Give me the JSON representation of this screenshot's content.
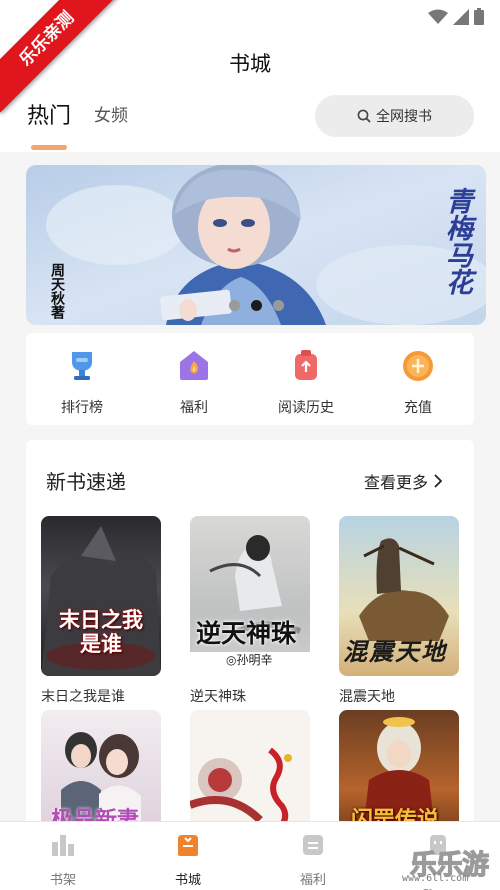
{
  "watermark_top": "乐乐亲测",
  "header": {
    "title": "书城"
  },
  "tabs": [
    {
      "label": "热门"
    },
    {
      "label": "女频"
    }
  ],
  "search": {
    "label": "全网搜书"
  },
  "banner": {
    "author_text": "周天秋著",
    "title_text": "青梅马花",
    "dots_active_index": 1
  },
  "quick": [
    {
      "label": "排行榜",
      "icon": "trophy-icon"
    },
    {
      "label": "福利",
      "icon": "gift-flame-icon"
    },
    {
      "label": "阅读历史",
      "icon": "history-icon"
    },
    {
      "label": "充值",
      "icon": "recharge-icon"
    }
  ],
  "new_books": {
    "title": "新书速递",
    "more": "查看更多",
    "items": [
      {
        "name": "末日之我是谁",
        "cover_text": "末日之我是谁"
      },
      {
        "name": "逆天神珠",
        "cover_text": "逆天神珠",
        "cover_sub": "◎孙明辛"
      },
      {
        "name": "混震天地",
        "cover_text": "混震天地"
      },
      {
        "name": "",
        "cover_text": "极品新妻"
      },
      {
        "name": "",
        "cover_text": ""
      },
      {
        "name": "",
        "cover_text": "闪罡传说"
      }
    ]
  },
  "tabbar": [
    {
      "label": "书架",
      "icon": "bookshelf-icon"
    },
    {
      "label": "书城",
      "icon": "bookstore-icon"
    },
    {
      "label": "福利",
      "icon": "welfare-icon"
    },
    {
      "label": "",
      "icon": "mine-icon"
    }
  ],
  "watermark_bottom": {
    "text": "乐乐游戏",
    "url": "www.6ll.com"
  },
  "colors": {
    "accent": "#f3a56a",
    "ribbon": "#e0161c"
  }
}
